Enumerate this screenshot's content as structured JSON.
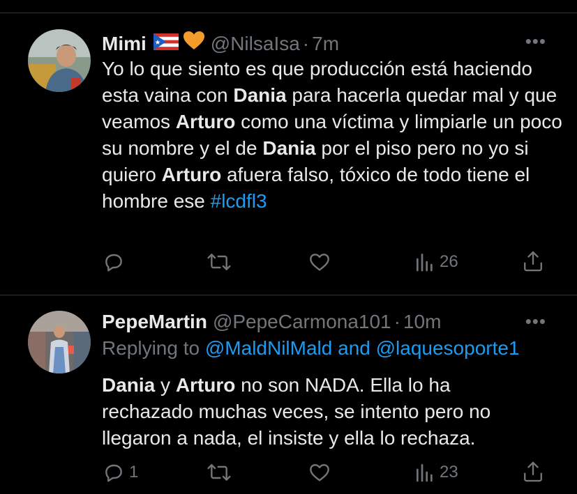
{
  "tweets": [
    {
      "display_name": "Mimi",
      "handle": "@NilsaIsa",
      "separator": "·",
      "time": "7m",
      "more": "•••",
      "text_segments": [
        {
          "t": "Yo lo que siento es que producción está haciendo esta vaina con ",
          "b": false
        },
        {
          "t": "Dania",
          "b": true
        },
        {
          "t": " para hacerla quedar mal y que veamos ",
          "b": false
        },
        {
          "t": "Arturo",
          "b": true
        },
        {
          "t": " como una víctima y limpiarle un poco su nombre y el de ",
          "b": false
        },
        {
          "t": "Dania",
          "b": true
        },
        {
          "t": " por el piso pero no yo si quiero ",
          "b": false
        },
        {
          "t": "Arturo",
          "b": true
        },
        {
          "t": " afuera falso, tóxico de todo tiene el hombre ese ",
          "b": false
        }
      ],
      "hashtag": "#lcdfl3",
      "reply_count": "",
      "views": "26"
    },
    {
      "display_name": "PepeMartin",
      "handle": "@PepeCarmona101",
      "separator": "·",
      "time": "10m",
      "more": "•••",
      "replying_prefix": "Replying to ",
      "replying_to_1": "@MaldNilMald",
      "replying_and": " and ",
      "replying_to_2": "@laquesoporte1",
      "text_segments": [
        {
          "t": "Dania",
          "b": true
        },
        {
          "t": " y ",
          "b": false
        },
        {
          "t": "Arturo",
          "b": true
        },
        {
          "t": " no son NADA. Ella lo ha rechazado muchas veces, se intento pero no llegaron a nada, el insiste y ella lo rechaza.",
          "b": false
        }
      ],
      "reply_count": "1",
      "views": "23"
    }
  ],
  "colors": {
    "background": "#000000",
    "text": "#e7e9ea",
    "secondary": "#71767b",
    "link": "#1d9bf0",
    "divider": "#2f3336"
  },
  "icons": [
    "reply-icon",
    "retweet-icon",
    "like-icon",
    "views-icon",
    "share-icon",
    "more-icon"
  ]
}
